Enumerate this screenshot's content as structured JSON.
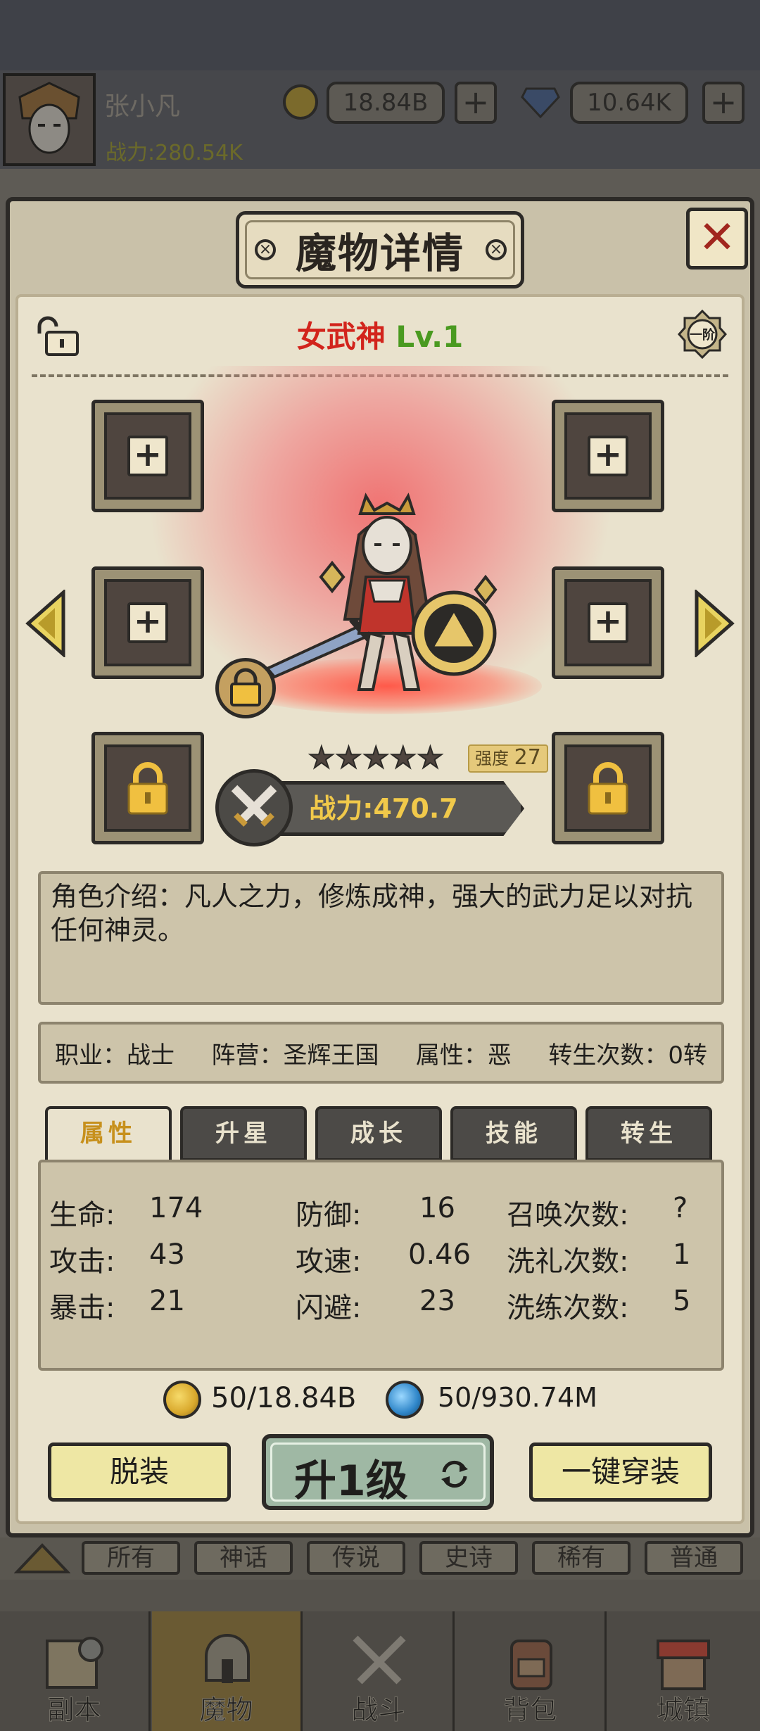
{
  "player": {
    "name": "张小凡",
    "power": "战力:280.54K",
    "gold": "18.84B",
    "diamonds": "10.64K"
  },
  "dialog": {
    "title": "魔物详情",
    "close_label": "✕"
  },
  "monster": {
    "name": "女武神",
    "level": "Lv.1",
    "rank_badge": "一阶",
    "stars": 5,
    "strength_label": "强度",
    "strength_value": "27",
    "power": "战力:470.7",
    "description": "角色介绍：凡人之力，修炼成神，强大的武力足以对抗任何神灵。"
  },
  "info": {
    "class": "职业：战士",
    "faction": "阵营：圣辉王国",
    "attribute": "属性：恶",
    "rebirth": "转生次数：0转"
  },
  "tabs": [
    "属性",
    "升星",
    "成长",
    "技能",
    "转生"
  ],
  "stats": [
    {
      "label": "生命:",
      "value": "174"
    },
    {
      "label": "防御:",
      "value": "16"
    },
    {
      "label": "召唤次数:",
      "value": "?"
    },
    {
      "label": "攻击:",
      "value": "43"
    },
    {
      "label": "攻速:",
      "value": "0.46"
    },
    {
      "label": "洗礼次数:",
      "value": "1"
    },
    {
      "label": "暴击:",
      "value": "21"
    },
    {
      "label": "闪避:",
      "value": "23"
    },
    {
      "label": "洗练次数:",
      "value": "5"
    }
  ],
  "costs": {
    "gold": "50/18.84B",
    "crystal": "50/930.74M"
  },
  "buttons": {
    "unequip": "脱装",
    "level_up": "升1级",
    "equip_all": "一键穿装"
  },
  "categories": [
    "所有",
    "神话",
    "传说",
    "史诗",
    "稀有",
    "普通"
  ],
  "nav": [
    "副本",
    "魔物",
    "战斗",
    "背包",
    "城镇"
  ],
  "colors": {
    "accent_gold": "#f1c94a",
    "name_red": "#d2241c",
    "level_green": "#4a9a20",
    "spotlight": "#f06e6e"
  }
}
